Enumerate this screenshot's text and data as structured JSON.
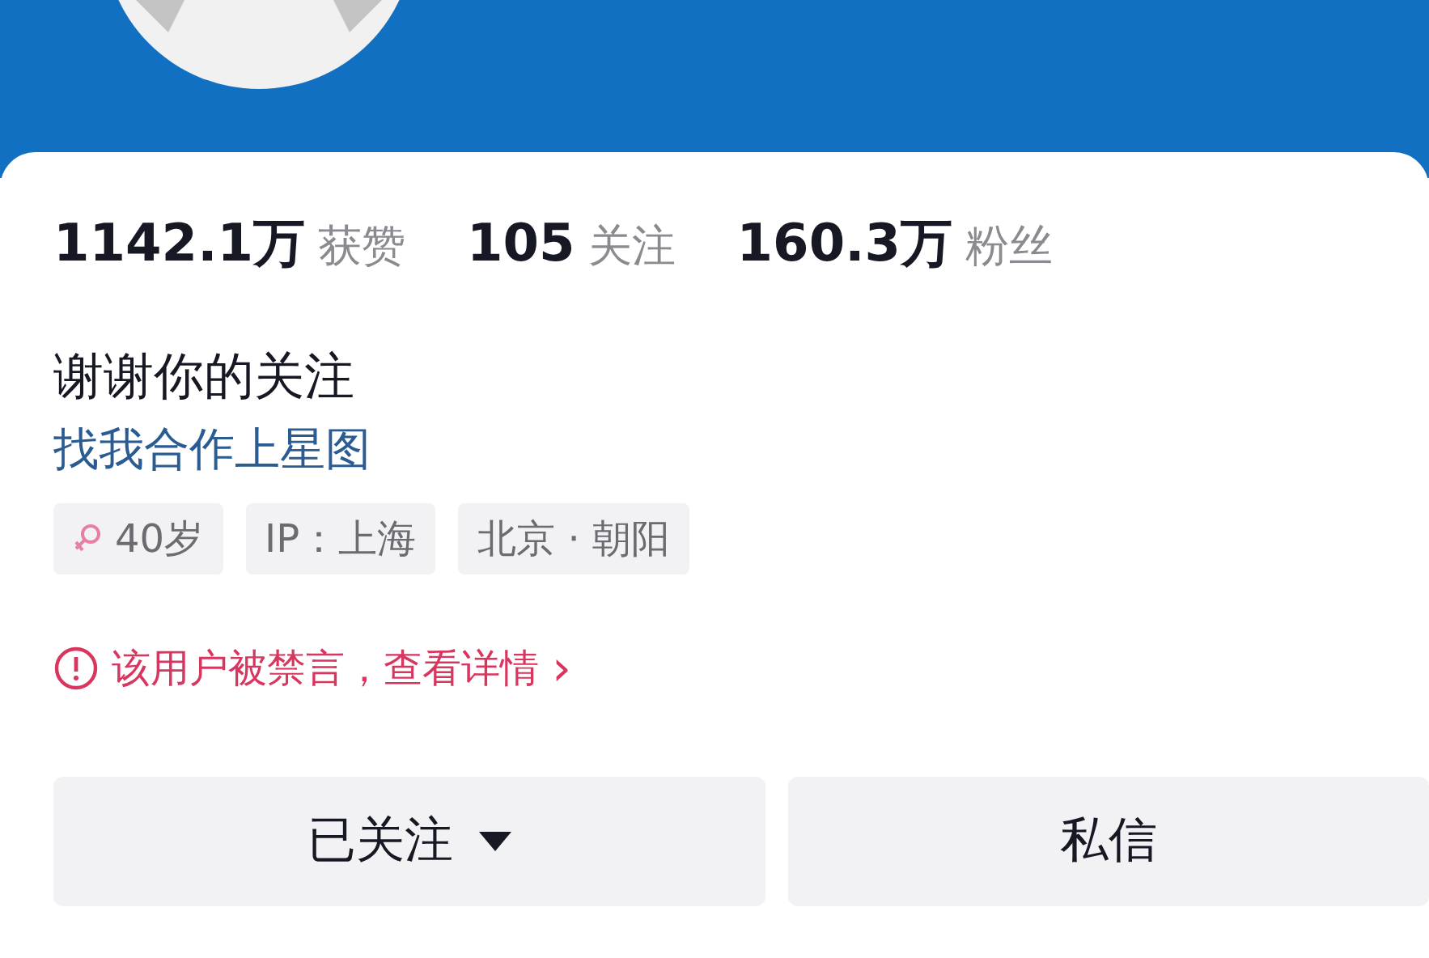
{
  "stats": [
    {
      "text": "1142.1万",
      "caption": "获赞"
    },
    {
      "text": "105",
      "caption": "关注"
    },
    {
      "text": "160.3万",
      "caption": "粉丝"
    }
  ],
  "bio": "谢谢你的关注",
  "link": "找我合作上星图",
  "tags": [
    {
      "kind": "gender",
      "text": "40岁"
    },
    {
      "kind": "text",
      "text": "IP：上海"
    },
    {
      "kind": "text",
      "text": "北京 · 朝阳"
    }
  ],
  "notice": {
    "text": "该用户被禁言，查看详情",
    "chevron": "›"
  },
  "buttons": [
    {
      "label": "已关注",
      "dropdown": true
    },
    {
      "label": "私信",
      "dropdown": false
    }
  ]
}
